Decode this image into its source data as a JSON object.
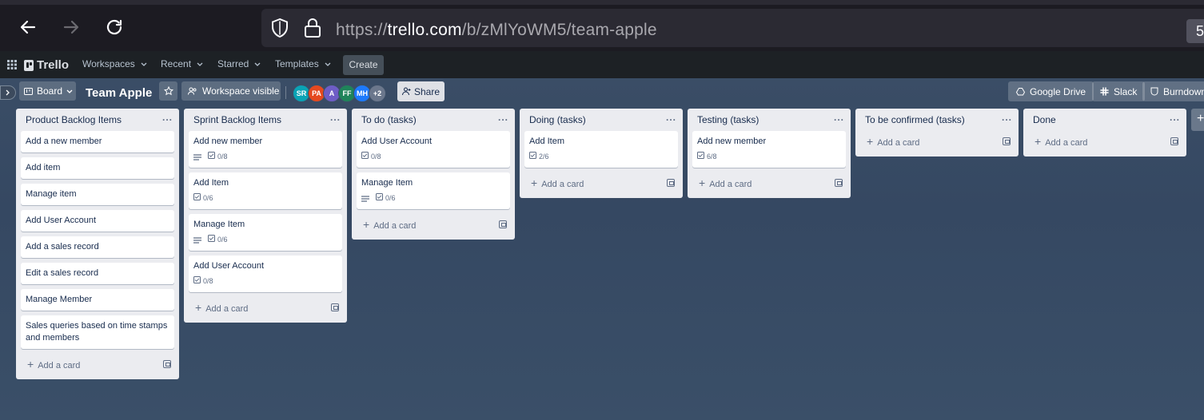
{
  "browser": {
    "url_prefix": "https://",
    "url_host": "trello.com",
    "url_path": "/b/zMlYoWM5/team-apple",
    "badge": "5"
  },
  "trello_header": {
    "logo": "Trello",
    "menus": [
      "Workspaces",
      "Recent",
      "Starred",
      "Templates"
    ],
    "create": "Create"
  },
  "board": {
    "view": "Board",
    "title": "Team Apple",
    "visibility": "Workspace visible",
    "members": [
      {
        "initials": "SR",
        "color": "#0aa3b5"
      },
      {
        "initials": "PA",
        "color": "#e5491f"
      },
      {
        "initials": "A",
        "color": "#6e5dc6"
      },
      {
        "initials": "FF",
        "color": "#1f845a"
      },
      {
        "initials": "MH",
        "color": "#1d7afc"
      }
    ],
    "more_members": "+2",
    "share": "Share",
    "powerups": [
      "Google Drive",
      "Slack",
      "Burndown"
    ]
  },
  "lists": [
    {
      "title": "Product Backlog Items",
      "cards": [
        {
          "title": "Add a new member"
        },
        {
          "title": "Add item"
        },
        {
          "title": "Manage item"
        },
        {
          "title": "Add User Account"
        },
        {
          "title": "Add a sales record"
        },
        {
          "title": "Edit a sales record"
        },
        {
          "title": "Manage Member"
        },
        {
          "title": "Sales queries based on time stamps and members"
        }
      ],
      "add_label": "Add a card"
    },
    {
      "title": "Sprint Backlog Items",
      "cards": [
        {
          "title": "Add new member",
          "desc": true,
          "checklist": "0/8"
        },
        {
          "title": "Add Item",
          "checklist": "0/6"
        },
        {
          "title": "Manage Item",
          "desc": true,
          "checklist": "0/6"
        },
        {
          "title": "Add User Account",
          "checklist": "0/8"
        }
      ],
      "add_label": "Add a card"
    },
    {
      "title": "To do (tasks)",
      "cards": [
        {
          "title": "Add User Account",
          "checklist": "0/8"
        },
        {
          "title": "Manage Item",
          "desc": true,
          "checklist": "0/6"
        }
      ],
      "add_label": "Add a card"
    },
    {
      "title": "Doing (tasks)",
      "cards": [
        {
          "title": "Add Item",
          "checklist": "2/6"
        }
      ],
      "add_label": "Add a card"
    },
    {
      "title": "Testing (tasks)",
      "cards": [
        {
          "title": "Add new member",
          "checklist": "6/8"
        }
      ],
      "add_label": "Add a card"
    },
    {
      "title": "To be confirmed (tasks)",
      "cards": [],
      "add_label": "Add a card"
    },
    {
      "title": "Done",
      "cards": [],
      "add_label": "Add a card"
    }
  ],
  "add_list": "+"
}
